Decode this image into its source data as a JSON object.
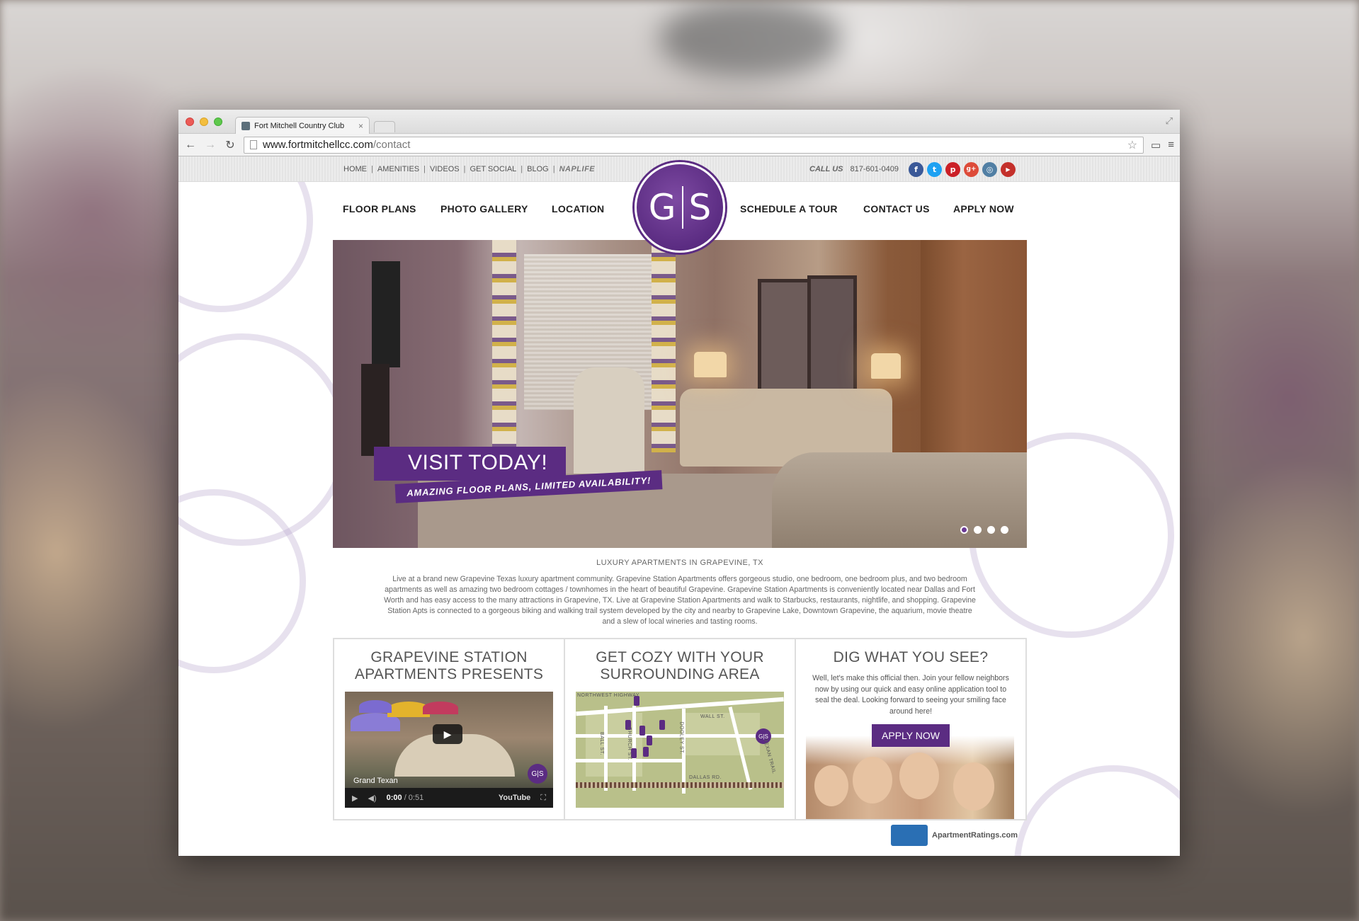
{
  "browser": {
    "tab_title": "Fort Mitchell Country Club",
    "tab_close": "×",
    "url_host": "www.fortmitchellcc.com",
    "url_path": "/contact"
  },
  "utility_nav": {
    "items": [
      "HOME",
      "AMENITIES",
      "VIDEOS",
      "GET SOCIAL",
      "BLOG",
      "NAPLIFE"
    ],
    "separator": "|",
    "call_label": "CALL US",
    "phone": "817-601-0409"
  },
  "social": {
    "facebook": "f",
    "twitter": "t",
    "pinterest": "p",
    "googleplus": "g+",
    "instagram": "◎",
    "youtube": "▶"
  },
  "logo": {
    "left": "G",
    "right": "S"
  },
  "main_nav": {
    "floor_plans": "FLOOR PLANS",
    "photo_gallery": "PHOTO GALLERY",
    "location": "LOCATION",
    "schedule_tour": "SCHEDULE A TOUR",
    "contact_us": "CONTACT US",
    "apply_now": "APPLY NOW"
  },
  "hero": {
    "headline": "VISIT TODAY!",
    "subline": "AMAZING FLOOR PLANS, LIMITED AVAILABILITY!",
    "slide_count": 4,
    "active_slide": 1
  },
  "intro": {
    "heading": "LUXURY APARTMENTS IN GRAPEVINE, TX",
    "body": "Live at a brand new Grapevine Texas luxury apartment community. Grapevine Station Apartments offers gorgeous studio, one bedroom, one bedroom plus, and two bedroom apartments as well as amazing two bedroom cottages / townhomes in the heart of beautiful Grapevine. Grapevine Station Apartments is conveniently located near Dallas and Fort Worth and has easy access to the many attractions in Grapevine, TX. Live at Grapevine Station Apartments and walk to Starbucks, restaurants, nightlife, and shopping. Grapevine Station Apts is connected to a gorgeous biking and walking trail system developed by the city and nearby to Grapevine Lake, Downtown Grapevine, the aquarium, movie theatre and a slew of local wineries and tasting rooms."
  },
  "panels": {
    "video": {
      "title_line1": "GRAPEVINE STATION",
      "title_line2": "APARTMENTS PRESENTS",
      "video_title": "Grand Texan",
      "time_current": "0:00",
      "time_total": "/ 0:51",
      "youtube": "YouTube"
    },
    "area": {
      "title_line1": "GET COZY WITH YOUR",
      "title_line2": "SURROUNDING AREA",
      "labels": {
        "highway": "NORTHWEST HIGHWAY",
        "wall": "WALL ST.",
        "dooley": "DOOLEY ST.",
        "texan": "TEXAN TRAIL",
        "dallas": "DALLAS RD.",
        "ball": "BALL ST.",
        "church": "CHURCH ST."
      }
    },
    "apply": {
      "title": "DIG WHAT YOU SEE?",
      "body": "Well, let's make this official then. Join your fellow neighbors now by using our quick and easy online application tool to seal the deal. Looking forward to seeing your smiling face around here!",
      "button": "APPLY NOW"
    }
  },
  "footer": {
    "partner": "ApartmentRatings.com"
  },
  "colors": {
    "brand_purple": "#5b2c82"
  }
}
